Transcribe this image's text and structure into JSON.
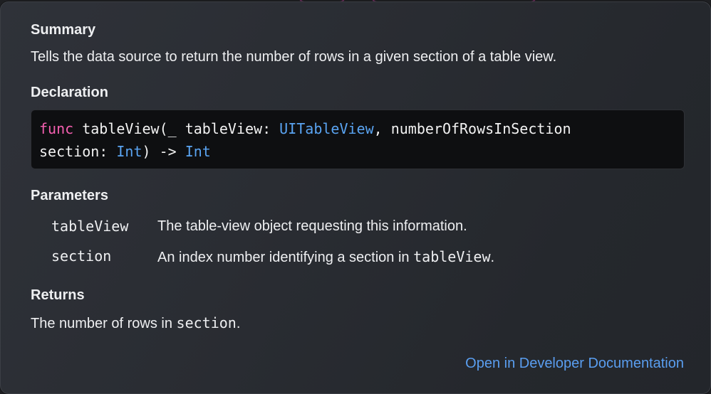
{
  "summary": {
    "heading": "Summary",
    "text": "Tells the data source to return the number of rows in a given section of a table view."
  },
  "declaration": {
    "heading": "Declaration",
    "line1": {
      "keyword": "func",
      "part1": " tableView(_ tableView: ",
      "type1": "UITableView",
      "part2": ", numberOfRowsInSection"
    },
    "line2": {
      "part1": "section: ",
      "type2": "Int",
      "part2": ") -> ",
      "type3": "Int"
    }
  },
  "parameters": {
    "heading": "Parameters",
    "items": [
      {
        "name": "tableView",
        "desc": "The table-view object requesting this information."
      },
      {
        "name": "section",
        "desc_prefix": "An index number identifying a section in ",
        "desc_code": "tableView",
        "desc_suffix": "."
      }
    ]
  },
  "returns": {
    "heading": "Returns",
    "prefix": "The number of rows in ",
    "code": "section",
    "suffix": "."
  },
  "link": {
    "label": "Open in Developer Documentation",
    "color": "#5a9ef0"
  },
  "colors": {
    "keyword": "#f45fb0",
    "type": "#5aa4f2"
  }
}
